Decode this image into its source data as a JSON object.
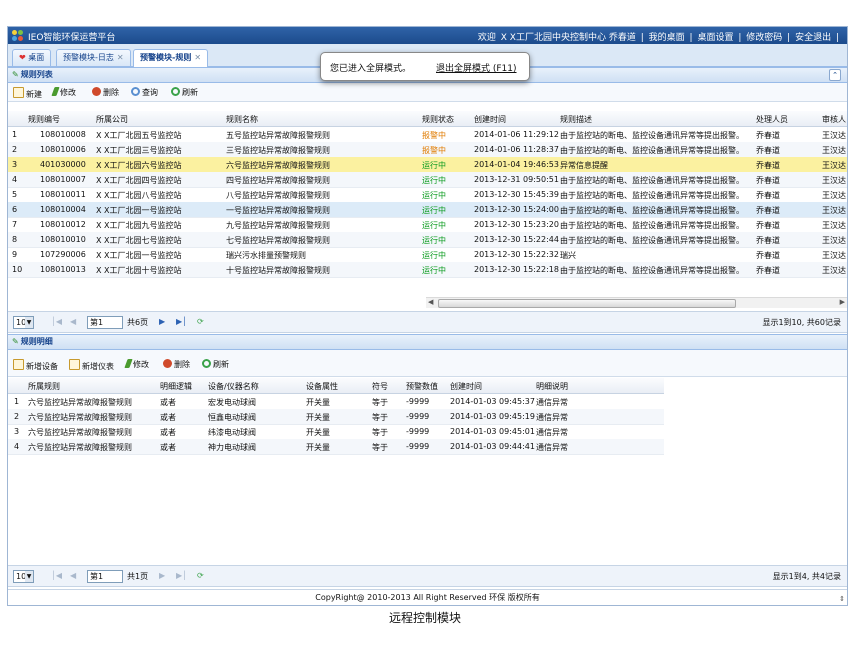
{
  "app_title": "IEO智能环保运营平台",
  "top_nav": {
    "welcome": "欢迎",
    "org_user": "X X工厂北园中央控制中心 乔春道",
    "links": [
      "我的桌面",
      "桌面设置",
      "修改密码",
      "安全退出"
    ]
  },
  "tabs": [
    {
      "label": "桌面",
      "active": false,
      "closable": false
    },
    {
      "label": "预警模块-日志",
      "active": false,
      "closable": true
    },
    {
      "label": "预警模块-规则",
      "active": true,
      "closable": true
    }
  ],
  "fullscreen_toast": {
    "message": "您已进入全屏模式。",
    "exit_link": "退出全屏模式 (F11)"
  },
  "rule_panel": {
    "title": "规则列表",
    "toolbar": [
      {
        "label": "新建",
        "icon": "new-icon"
      },
      {
        "label": "修改",
        "icon": "edit-icon"
      },
      {
        "label": "删除",
        "icon": "delete-icon"
      },
      {
        "label": "查询",
        "icon": "search-icon"
      },
      {
        "label": "刷新",
        "icon": "refresh-icon"
      }
    ],
    "columns": [
      "规则编号",
      "所属公司",
      "规则名称",
      "规则状态",
      "创建时间",
      "规则描述",
      "处理人员",
      "审核人"
    ],
    "rows": [
      {
        "no": "1",
        "id": "108010008",
        "company": "X X工厂北园五号监控站",
        "name": "五号监控站异常故障报警规则",
        "status": "报警中",
        "created": "2014-01-06 11:29:12",
        "desc": "由于监控站的断电、监控设备通讯异常等提出报警。",
        "handler": "乔春道",
        "auditor": "王汉达"
      },
      {
        "no": "2",
        "id": "108010006",
        "company": "X X工厂北园三号监控站",
        "name": "三号监控站异常故障报警规则",
        "status": "报警中",
        "created": "2014-01-06 11:28:37",
        "desc": "由于监控站的断电、监控设备通讯异常等提出报警。",
        "handler": "乔春道",
        "auditor": "王汉达"
      },
      {
        "no": "3",
        "id": "401030000",
        "company": "X X工厂北园六号监控站",
        "name": "六号监控站异常故障报警规则",
        "status": "运行中",
        "created": "2014-01-04 19:46:53",
        "desc": "异常信息提醒",
        "handler": "乔春道",
        "auditor": "王汉达"
      },
      {
        "no": "4",
        "id": "108010007",
        "company": "X X工厂北园四号监控站",
        "name": "四号监控站异常故障报警规则",
        "status": "运行中",
        "created": "2013-12-31 09:50:51",
        "desc": "由于监控站的断电、监控设备通讯异常等提出报警。",
        "handler": "乔春道",
        "auditor": "王汉达"
      },
      {
        "no": "5",
        "id": "108010011",
        "company": "X X工厂北园八号监控站",
        "name": "八号监控站异常故障报警规则",
        "status": "运行中",
        "created": "2013-12-30 15:45:39",
        "desc": "由于监控站的断电、监控设备通讯异常等提出报警。",
        "handler": "乔春道",
        "auditor": "王汉达"
      },
      {
        "no": "6",
        "id": "108010004",
        "company": "X X工厂北园一号监控站",
        "name": "一号监控站异常故障报警规则",
        "status": "运行中",
        "created": "2013-12-30 15:24:00",
        "desc": "由于监控站的断电、监控设备通讯异常等提出报警。",
        "handler": "乔春道",
        "auditor": "王汉达"
      },
      {
        "no": "7",
        "id": "108010012",
        "company": "X X工厂北园九号监控站",
        "name": "九号监控站异常故障报警规则",
        "status": "运行中",
        "created": "2013-12-30 15:23:20",
        "desc": "由于监控站的断电、监控设备通讯异常等提出报警。",
        "handler": "乔春道",
        "auditor": "王汉达"
      },
      {
        "no": "8",
        "id": "108010010",
        "company": "X X工厂北园七号监控站",
        "name": "七号监控站异常故障报警规则",
        "status": "运行中",
        "created": "2013-12-30 15:22:44",
        "desc": "由于监控站的断电、监控设备通讯异常等提出报警。",
        "handler": "乔春道",
        "auditor": "王汉达"
      },
      {
        "no": "9",
        "id": "107290006",
        "company": "X X工厂北园一号监控站",
        "name": "瑞兴污水排量预警规则",
        "status": "运行中",
        "created": "2013-12-30 15:22:32",
        "desc": "瑞兴",
        "handler": "乔春道",
        "auditor": "王汉达"
      },
      {
        "no": "10",
        "id": "108010013",
        "company": "X X工厂北园十号监控站",
        "name": "十号监控站异常故障报警规则",
        "status": "运行中",
        "created": "2013-12-30 15:22:18",
        "desc": "由于监控站的断电、监控设备通讯异常等提出报警。",
        "handler": "乔春道",
        "auditor": "王汉达"
      }
    ],
    "pager": {
      "page_size": "10",
      "page": "第1",
      "total_pages": "共6页",
      "info": "显示1到10, 共60记录"
    }
  },
  "detail_panel": {
    "title": "规则明细",
    "toolbar": [
      {
        "label": "新增设备",
        "icon": "add-device-icon"
      },
      {
        "label": "新增仪表",
        "icon": "add-meter-icon"
      },
      {
        "label": "修改",
        "icon": "edit-icon"
      },
      {
        "label": "删除",
        "icon": "delete-icon"
      },
      {
        "label": "刷新",
        "icon": "refresh-icon"
      }
    ],
    "columns": [
      "所属规则",
      "明细逻辑",
      "设备/仪器名称",
      "设备属性",
      "符号",
      "预警数值",
      "创建时间",
      "明细说明"
    ],
    "rows": [
      {
        "no": "1",
        "rule": "六号监控站异常故障报警规则",
        "logic": "或者",
        "device": "宏发电动球阀",
        "attr": "开关量",
        "symbol": "等于",
        "value": "-9999",
        "created": "2014-01-03 09:45:37",
        "note": "通信异常"
      },
      {
        "no": "2",
        "rule": "六号监控站异常故障报警规则",
        "logic": "或者",
        "device": "恒鑫电动球阀",
        "attr": "开关量",
        "symbol": "等于",
        "value": "-9999",
        "created": "2014-01-03 09:45:19",
        "note": "通信异常"
      },
      {
        "no": "3",
        "rule": "六号监控站异常故障报警规则",
        "logic": "或者",
        "device": "纬漆电动球阀",
        "attr": "开关量",
        "symbol": "等于",
        "value": "-9999",
        "created": "2014-01-03 09:45:01",
        "note": "通信异常"
      },
      {
        "no": "4",
        "rule": "六号监控站异常故障报警规则",
        "logic": "或者",
        "device": "神力电动球阀",
        "attr": "开关量",
        "symbol": "等于",
        "value": "-9999",
        "created": "2014-01-03 09:44:41",
        "note": "通信异常"
      }
    ],
    "pager": {
      "page_size": "10",
      "page": "第1",
      "total_pages": "共1页",
      "info": "显示1到4, 共4记录"
    }
  },
  "footer": "CopyRight@ 2010-2013 All Right Reserved    环保 版权所有",
  "caption": "远程控制模块"
}
